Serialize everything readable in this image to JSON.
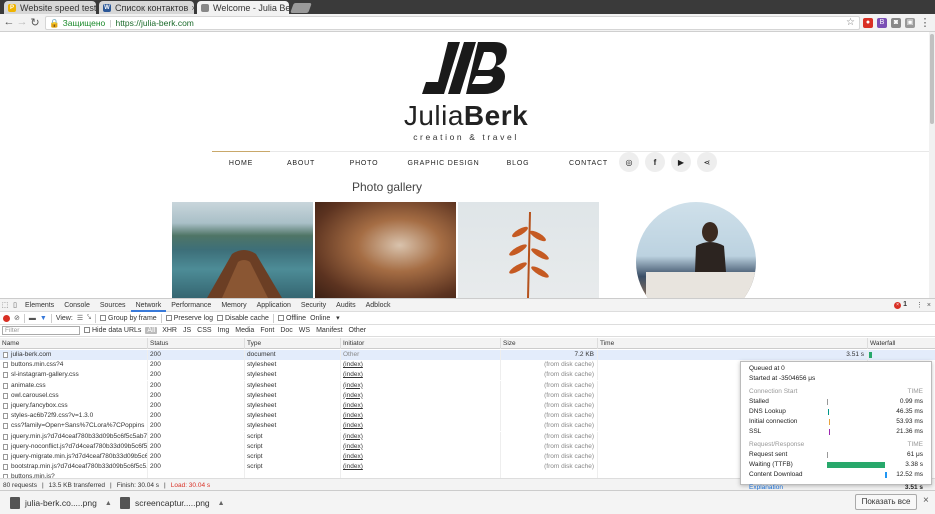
{
  "browser": {
    "tabs": [
      {
        "title": "Website speed test",
        "favicon_color": "#f0b400",
        "favicon_letter": "P"
      },
      {
        "title": "Список контактов",
        "favicon_color": "#2b5797",
        "favicon_letter": "W"
      },
      {
        "title": "Welcome - Julia Be",
        "favicon_color": "#888888",
        "favicon_letter": "",
        "active": true
      }
    ],
    "address": {
      "secure_label": "Защищено",
      "url": "https://julia-berk.com"
    }
  },
  "site": {
    "brand_first": "Julia",
    "brand_second": "Berk",
    "tagline": "creation & travel",
    "nav": [
      "HOME",
      "ABOUT",
      "PHOTO",
      "GRAPHIC DESIGN",
      "BLOG",
      "CONTACT"
    ],
    "gallery_title": "Photo gallery"
  },
  "devtools": {
    "tabs": [
      "Elements",
      "Console",
      "Sources",
      "Network",
      "Performance",
      "Memory",
      "Application",
      "Security",
      "Audits",
      "Adblock"
    ],
    "active_tab": "Network",
    "error_count": "1",
    "toolbar": {
      "view_label": "View:",
      "group_by_frame": "Group by frame",
      "preserve_log": "Preserve log",
      "disable_cache": "Disable cache",
      "offline": "Offline",
      "throttle": "Online"
    },
    "filter_placeholder": "Filter",
    "hide_data_urls": "Hide data URLs",
    "filter_types": [
      "All",
      "XHR",
      "JS",
      "CSS",
      "Img",
      "Media",
      "Font",
      "Doc",
      "WS",
      "Manifest",
      "Other"
    ],
    "columns": [
      "Name",
      "Status",
      "Type",
      "Initiator",
      "Size",
      "Time",
      "Waterfall"
    ],
    "rows": [
      {
        "name": "julia-berk.com",
        "status": "200",
        "type": "document",
        "initiator": "Other",
        "size": "7.2 KB",
        "time": "3.51 s"
      },
      {
        "name": "buttons.min.css?4",
        "status": "200",
        "type": "stylesheet",
        "initiator": "(index)",
        "size": "(from disk cache)",
        "time": ""
      },
      {
        "name": "sl-instagram-gallery.css",
        "status": "200",
        "type": "stylesheet",
        "initiator": "(index)",
        "size": "(from disk cache)",
        "time": ""
      },
      {
        "name": "animate.css",
        "status": "200",
        "type": "stylesheet",
        "initiator": "(index)",
        "size": "(from disk cache)",
        "time": ""
      },
      {
        "name": "owl.carousel.css",
        "status": "200",
        "type": "stylesheet",
        "initiator": "(index)",
        "size": "(from disk cache)",
        "time": ""
      },
      {
        "name": "jquery.fancybox.css",
        "status": "200",
        "type": "stylesheet",
        "initiator": "(index)",
        "size": "(from disk cache)",
        "time": ""
      },
      {
        "name": "styles-ac6b72f9.css?v=1.3.0",
        "status": "200",
        "type": "stylesheet",
        "initiator": "(index)",
        "size": "(from disk cache)",
        "time": ""
      },
      {
        "name": "css?family=Open+Sans%7CLora%7CPoppins",
        "status": "200",
        "type": "stylesheet",
        "initiator": "(index)",
        "size": "(from disk cache)",
        "time": ""
      },
      {
        "name": "jquery.min.js?d7d4ceaf780b33d09b5c6f5c5ab7...",
        "status": "200",
        "type": "script",
        "initiator": "(index)",
        "size": "(from disk cache)",
        "time": ""
      },
      {
        "name": "jquery-noconflict.js?d7d4ceaf780b33d09b5c6f5...",
        "status": "200",
        "type": "script",
        "initiator": "(index)",
        "size": "(from disk cache)",
        "time": ""
      },
      {
        "name": "jquery-migrate.min.js?d7d4ceaf780b33d09b5c6...",
        "status": "200",
        "type": "script",
        "initiator": "(index)",
        "size": "(from disk cache)",
        "time": ""
      },
      {
        "name": "bootstrap.min.js?d7d4ceaf780b33d09b5c6f5c5...",
        "status": "200",
        "type": "script",
        "initiator": "(index)",
        "size": "(from disk cache)",
        "time": ""
      },
      {
        "name": "buttons.min.js?",
        "status": "",
        "type": "",
        "initiator": "",
        "size": "",
        "time": ""
      }
    ],
    "status": {
      "requests": "80 requests",
      "transferred": "13.5 KB transferred",
      "finish": "Finish: 30.04 s",
      "load": "Load: 30.04 s"
    },
    "timing_popup": {
      "queued": "Queued at 0",
      "started": "Started at -3504656 μs",
      "connection_heading": "Connection Start",
      "request_heading": "Request/Response",
      "time_label": "TIME",
      "connection": [
        {
          "label": "Stalled",
          "time": "0.99 ms"
        },
        {
          "label": "DNS Lookup",
          "time": "46.35 ms"
        },
        {
          "label": "Initial connection",
          "time": "53.93 ms"
        },
        {
          "label": "SSL",
          "time": "21.36 ms"
        }
      ],
      "request": [
        {
          "label": "Request sent",
          "time": "61 μs"
        },
        {
          "label": "Waiting (TTFB)",
          "time": "3.38 s"
        },
        {
          "label": "Content Download",
          "time": "12.52 ms"
        }
      ],
      "explanation": "Explanation",
      "total": "3.51 s"
    }
  },
  "downloads": {
    "items": [
      "julia-berk.co.....png",
      "screencaptur.....png"
    ],
    "show_all": "Показать все"
  },
  "colors": {
    "accent": "#3879d9",
    "waterfall_bar": "#28a86b",
    "error": "#d93025",
    "secure": "#1a8a2a"
  }
}
